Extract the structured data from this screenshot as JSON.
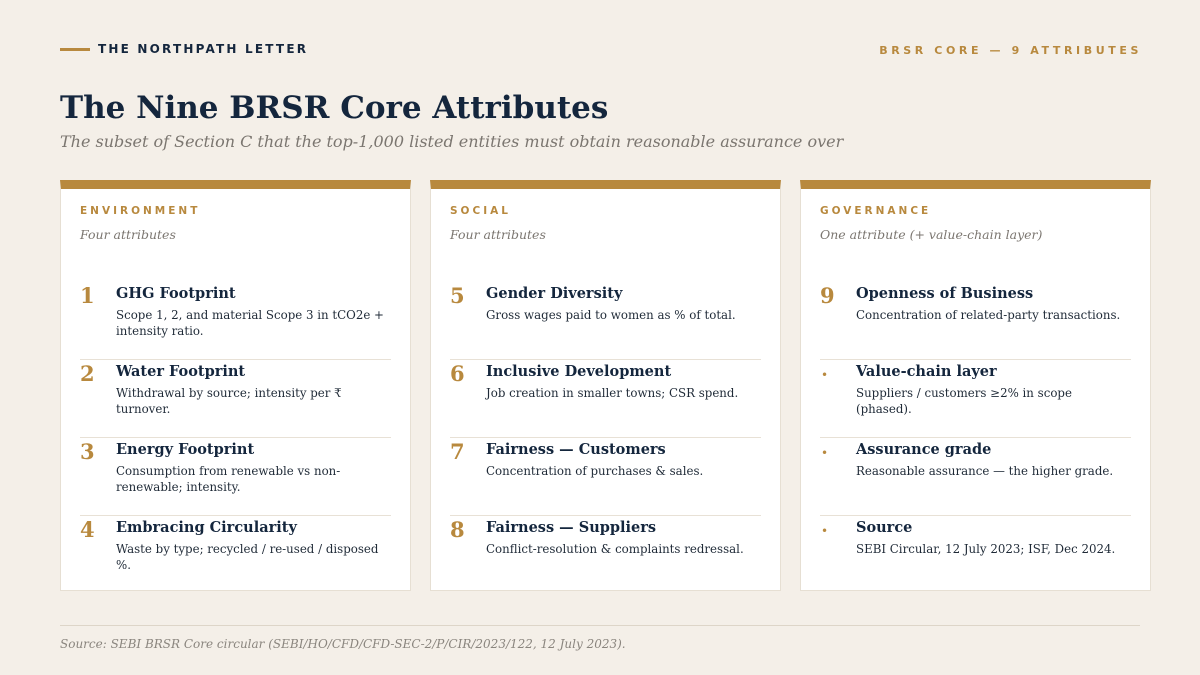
{
  "header": {
    "brand": "THE NORTHPATH LETTER",
    "kicker": "BRSR CORE — 9 ATTRIBUTES"
  },
  "title": "The Nine BRSR Core Attributes",
  "subtitle": "The subset of Section C that the top-1,000 listed entities must obtain reasonable assurance over",
  "colors": {
    "accent": "#b8893e",
    "navy": "#14263d",
    "background": "#f4efe8"
  },
  "columns": [
    {
      "label": "ENVIRONMENT",
      "subtitle": "Four attributes",
      "items": [
        {
          "marker": "1",
          "title": "GHG Footprint",
          "desc": "Scope 1, 2, and material Scope 3 in tCO2e + intensity ratio."
        },
        {
          "marker": "2",
          "title": "Water Footprint",
          "desc": "Withdrawal by source; intensity per ₹ turnover."
        },
        {
          "marker": "3",
          "title": "Energy Footprint",
          "desc": "Consumption from renewable vs non-renewable; intensity."
        },
        {
          "marker": "4",
          "title": "Embracing Circularity",
          "desc": "Waste by type; recycled / re-used / disposed %."
        }
      ]
    },
    {
      "label": "SOCIAL",
      "subtitle": "Four attributes",
      "items": [
        {
          "marker": "5",
          "title": "Gender Diversity",
          "desc": "Gross wages paid to women as % of total."
        },
        {
          "marker": "6",
          "title": "Inclusive Development",
          "desc": "Job creation in smaller towns; CSR spend."
        },
        {
          "marker": "7",
          "title": "Fairness — Customers",
          "desc": "Concentration of purchases & sales."
        },
        {
          "marker": "8",
          "title": "Fairness — Suppliers",
          "desc": "Conflict-resolution & complaints redressal."
        }
      ]
    },
    {
      "label": "GOVERNANCE",
      "subtitle": "One attribute (+ value-chain layer)",
      "items": [
        {
          "marker": "9",
          "title": "Openness of Business",
          "desc": "Concentration of related-party transactions."
        },
        {
          "marker": "•",
          "title": "Value-chain layer",
          "desc": "Suppliers / customers ≥2% in scope (phased)."
        },
        {
          "marker": "•",
          "title": "Assurance grade",
          "desc": "Reasonable assurance — the higher grade."
        },
        {
          "marker": "•",
          "title": "Source",
          "desc": "SEBI Circular, 12 July 2023; ISF, Dec 2024."
        }
      ]
    }
  ],
  "footer": "Source: SEBI BRSR Core circular (SEBI/HO/CFD/CFD-SEC-2/P/CIR/2023/122, 12 July 2023)."
}
